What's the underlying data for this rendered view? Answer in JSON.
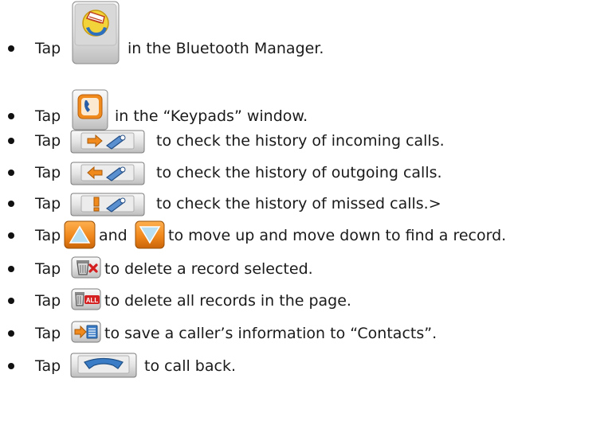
{
  "instructions": [
    {
      "before": "Tap",
      "icon": "bluetooth-phone-icon",
      "after": "in the Bluetooth Manager."
    },
    {
      "before": "Tap",
      "icon": "keypad-phone-icon",
      "after": "in the “Keypads” window."
    },
    {
      "before": "Tap",
      "icon": "incoming-calls-icon",
      "after": "to check the history of incoming calls."
    },
    {
      "before": "Tap",
      "icon": "outgoing-calls-icon",
      "after": "to check the history of outgoing calls."
    },
    {
      "before": "Tap",
      "icon": "missed-calls-icon",
      "after": "to check the history of missed calls.>"
    },
    {
      "before": "Tap",
      "icon": "up-arrow-icon",
      "middle": "and",
      "icon2": "down-arrow-icon",
      "after": "to move up and move down to find a record."
    },
    {
      "before": "Tap",
      "icon": "delete-record-icon",
      "after": "to delete a record selected."
    },
    {
      "before": "Tap",
      "icon": "delete-all-icon",
      "after": "to delete all records in the page."
    },
    {
      "before": "Tap",
      "icon": "save-contact-icon",
      "after": "to save a caller’s information to “Contacts”."
    },
    {
      "before": "Tap",
      "icon": "call-back-icon",
      "after": "to call back."
    }
  ],
  "icon_texts": {
    "delete_all_badge": "ALL"
  },
  "colors": {
    "text": "#1a1a1a",
    "button_face": "#e2e2e2",
    "orange": "#f08a1c",
    "red_x": "#d42020",
    "phone_blue": "#3a7dc6"
  }
}
